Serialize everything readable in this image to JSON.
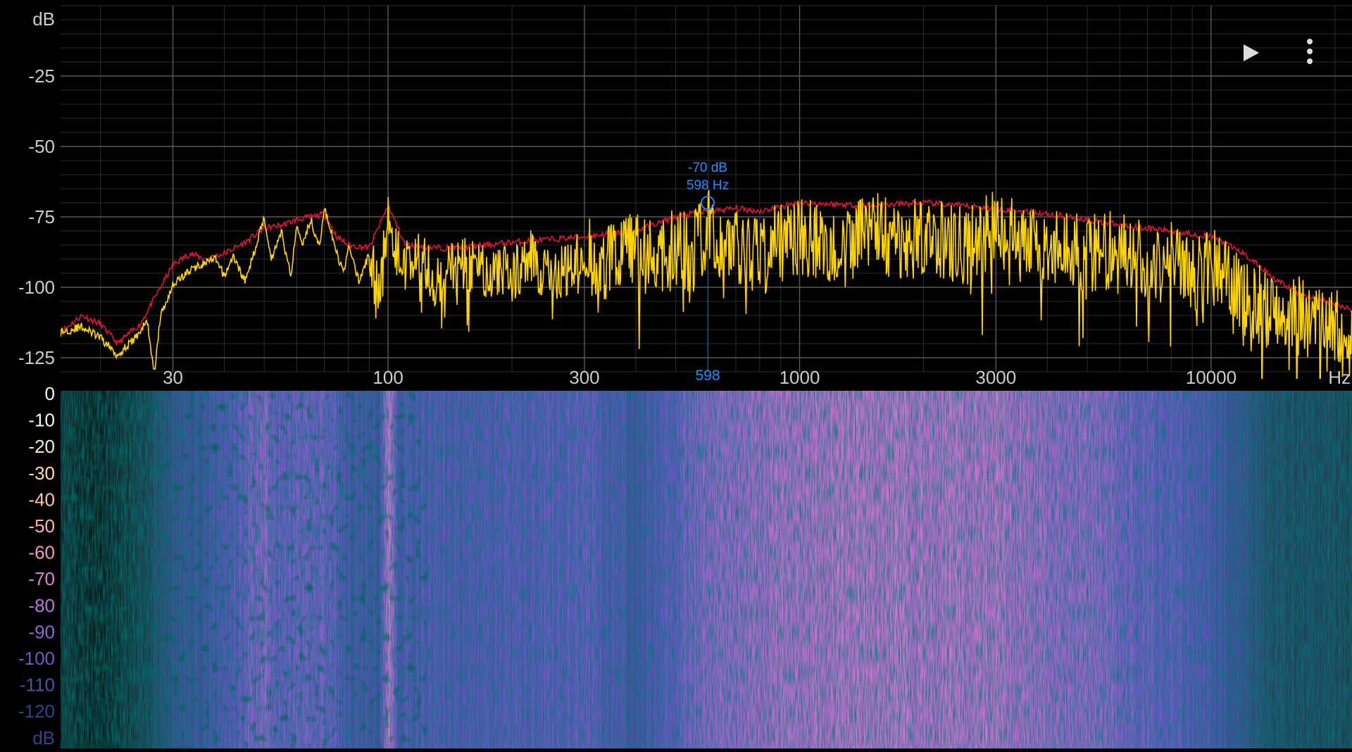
{
  "colors": {
    "background": "#000000",
    "grid_major": "#5a5a5a",
    "grid_minor": "#2c2c2c",
    "axis_text": "#cccccc",
    "peak_hold": "#e0123a",
    "spectrum": "#ffd500",
    "cursor": "#1e90ff"
  },
  "controls": {
    "play_icon": "play-icon",
    "menu_icon": "more-vert-icon"
  },
  "chart_data": [
    {
      "type": "line",
      "x_scale": "log",
      "xlim": [
        16,
        22000
      ],
      "ylim": [
        -135,
        2
      ],
      "grid": true,
      "xticks": [
        {
          "value": 30,
          "label": "30"
        },
        {
          "value": 100,
          "label": "100"
        },
        {
          "value": 300,
          "label": "300"
        },
        {
          "value": 1000,
          "label": "1000"
        },
        {
          "value": 3000,
          "label": "3000"
        },
        {
          "value": 10000,
          "label": "10000"
        }
      ],
      "xunit": "Hz",
      "yticks": [
        {
          "value": -25,
          "label": "-25"
        },
        {
          "value": -50,
          "label": "-50"
        },
        {
          "value": -75,
          "label": "-75"
        },
        {
          "value": -100,
          "label": "-100"
        },
        {
          "value": -125,
          "label": "-125"
        }
      ],
      "yunit": "dB",
      "series": [
        {
          "role": "peak-hold",
          "color": "#e0123a",
          "x": [
            16,
            18,
            20,
            22,
            25,
            28,
            30,
            33,
            36,
            40,
            45,
            50,
            55,
            60,
            65,
            70,
            75,
            80,
            90,
            100,
            110,
            130,
            150,
            200,
            250,
            300,
            400,
            500,
            600,
            700,
            800,
            1000,
            1500,
            2000,
            3000,
            4000,
            5000,
            6000,
            8000,
            10000,
            12000,
            14000,
            16000,
            18000,
            20000,
            22000
          ],
          "y": [
            -116,
            -110,
            -113,
            -120,
            -113,
            -100,
            -92,
            -88,
            -90,
            -88,
            -84,
            -79,
            -78,
            -76,
            -75,
            -74,
            -82,
            -85,
            -86,
            -71,
            -85,
            -86,
            -86,
            -84,
            -83,
            -82,
            -80,
            -75,
            -73,
            -72,
            -73,
            -70,
            -71,
            -70,
            -72,
            -74,
            -76,
            -78,
            -80,
            -82,
            -88,
            -96,
            -102,
            -104,
            -106,
            -108
          ]
        },
        {
          "role": "spectrum",
          "color": "#ffd500",
          "x": [
            16,
            18,
            20,
            22,
            24,
            26,
            27,
            28,
            30,
            33,
            35,
            38,
            40,
            42,
            45,
            48,
            50,
            52,
            55,
            58,
            60,
            62,
            65,
            68,
            70,
            72,
            75,
            78,
            80,
            85,
            90,
            95,
            100,
            105,
            110,
            120,
            130,
            150,
            180,
            200,
            220,
            250,
            280,
            300,
            330,
            360,
            400,
            450,
            500,
            550,
            598,
            650,
            700,
            800,
            900,
            1000,
            1200,
            1500,
            1800,
            2000,
            2500,
            3000,
            3500,
            4000,
            5000,
            6000,
            7000,
            8000,
            9000,
            10000,
            11000,
            12000,
            14000,
            16000,
            18000,
            20000,
            22000
          ],
          "y": [
            -116,
            -114,
            -118,
            -124,
            -119,
            -112,
            -131,
            -110,
            -99,
            -94,
            -92,
            -90,
            -96,
            -89,
            -98,
            -84,
            -75,
            -90,
            -80,
            -96,
            -78,
            -84,
            -76,
            -86,
            -72,
            -78,
            -88,
            -95,
            -85,
            -98,
            -88,
            -104,
            -70,
            -88,
            -92,
            -90,
            -98,
            -92,
            -94,
            -96,
            -89,
            -98,
            -92,
            -85,
            -93,
            -86,
            -88,
            -90,
            -86,
            -88,
            -78,
            -90,
            -85,
            -88,
            -84,
            -82,
            -86,
            -80,
            -84,
            -81,
            -86,
            -79,
            -85,
            -84,
            -88,
            -86,
            -92,
            -91,
            -96,
            -92,
            -98,
            -104,
            -108,
            -110,
            -112,
            -114,
            -122
          ]
        }
      ],
      "cursor": {
        "frequency": 598,
        "level": -70,
        "level_label": "-70 dB",
        "freq_label": "598 Hz",
        "axis_label": "598"
      }
    },
    {
      "type": "heatmap",
      "x_scale": "log",
      "xlim": [
        16,
        22000
      ],
      "color_scale": {
        "unit": "dB",
        "ticks": [
          {
            "value": 0,
            "label": "0",
            "color": "#ffffff"
          },
          {
            "value": -10,
            "label": "-10",
            "color": "#fff6e6"
          },
          {
            "value": -20,
            "label": "-20",
            "color": "#ffeccc"
          },
          {
            "value": -30,
            "label": "-30",
            "color": "#ffd9b0"
          },
          {
            "value": -40,
            "label": "-40",
            "color": "#ffc6a6"
          },
          {
            "value": -50,
            "label": "-50",
            "color": "#ffb0b0"
          },
          {
            "value": -60,
            "label": "-60",
            "color": "#f09ac0"
          },
          {
            "value": -70,
            "label": "-70",
            "color": "#d886d0"
          },
          {
            "value": -80,
            "label": "-80",
            "color": "#b878d8"
          },
          {
            "value": -90,
            "label": "-90",
            "color": "#8d6ad0"
          },
          {
            "value": -100,
            "label": "-100",
            "color": "#6a5cc0"
          },
          {
            "value": -110,
            "label": "-110",
            "color": "#4f4fa8"
          },
          {
            "value": -120,
            "label": "-120",
            "color": "#3a3f8c"
          }
        ]
      },
      "column_levels": [
        {
          "freq": 16,
          "level": -124
        },
        {
          "freq": 20,
          "level": -128
        },
        {
          "freq": 25,
          "level": -118
        },
        {
          "freq": 30,
          "level": -104
        },
        {
          "freq": 40,
          "level": -96
        },
        {
          "freq": 50,
          "level": -86
        },
        {
          "freq": 55,
          "level": -92
        },
        {
          "freq": 70,
          "level": -90
        },
        {
          "freq": 80,
          "level": -98
        },
        {
          "freq": 95,
          "level": -100
        },
        {
          "freq": 100,
          "level": -76
        },
        {
          "freq": 105,
          "level": -96
        },
        {
          "freq": 150,
          "level": -96
        },
        {
          "freq": 300,
          "level": -93
        },
        {
          "freq": 400,
          "level": -99
        },
        {
          "freq": 600,
          "level": -86
        },
        {
          "freq": 1000,
          "level": -80
        },
        {
          "freq": 2000,
          "level": -80
        },
        {
          "freq": 3000,
          "level": -80
        },
        {
          "freq": 5000,
          "level": -86
        },
        {
          "freq": 8000,
          "level": -93
        },
        {
          "freq": 10000,
          "level": -97
        },
        {
          "freq": 12000,
          "level": -104
        },
        {
          "freq": 14000,
          "level": -112
        },
        {
          "freq": 22000,
          "level": -116
        }
      ]
    }
  ]
}
